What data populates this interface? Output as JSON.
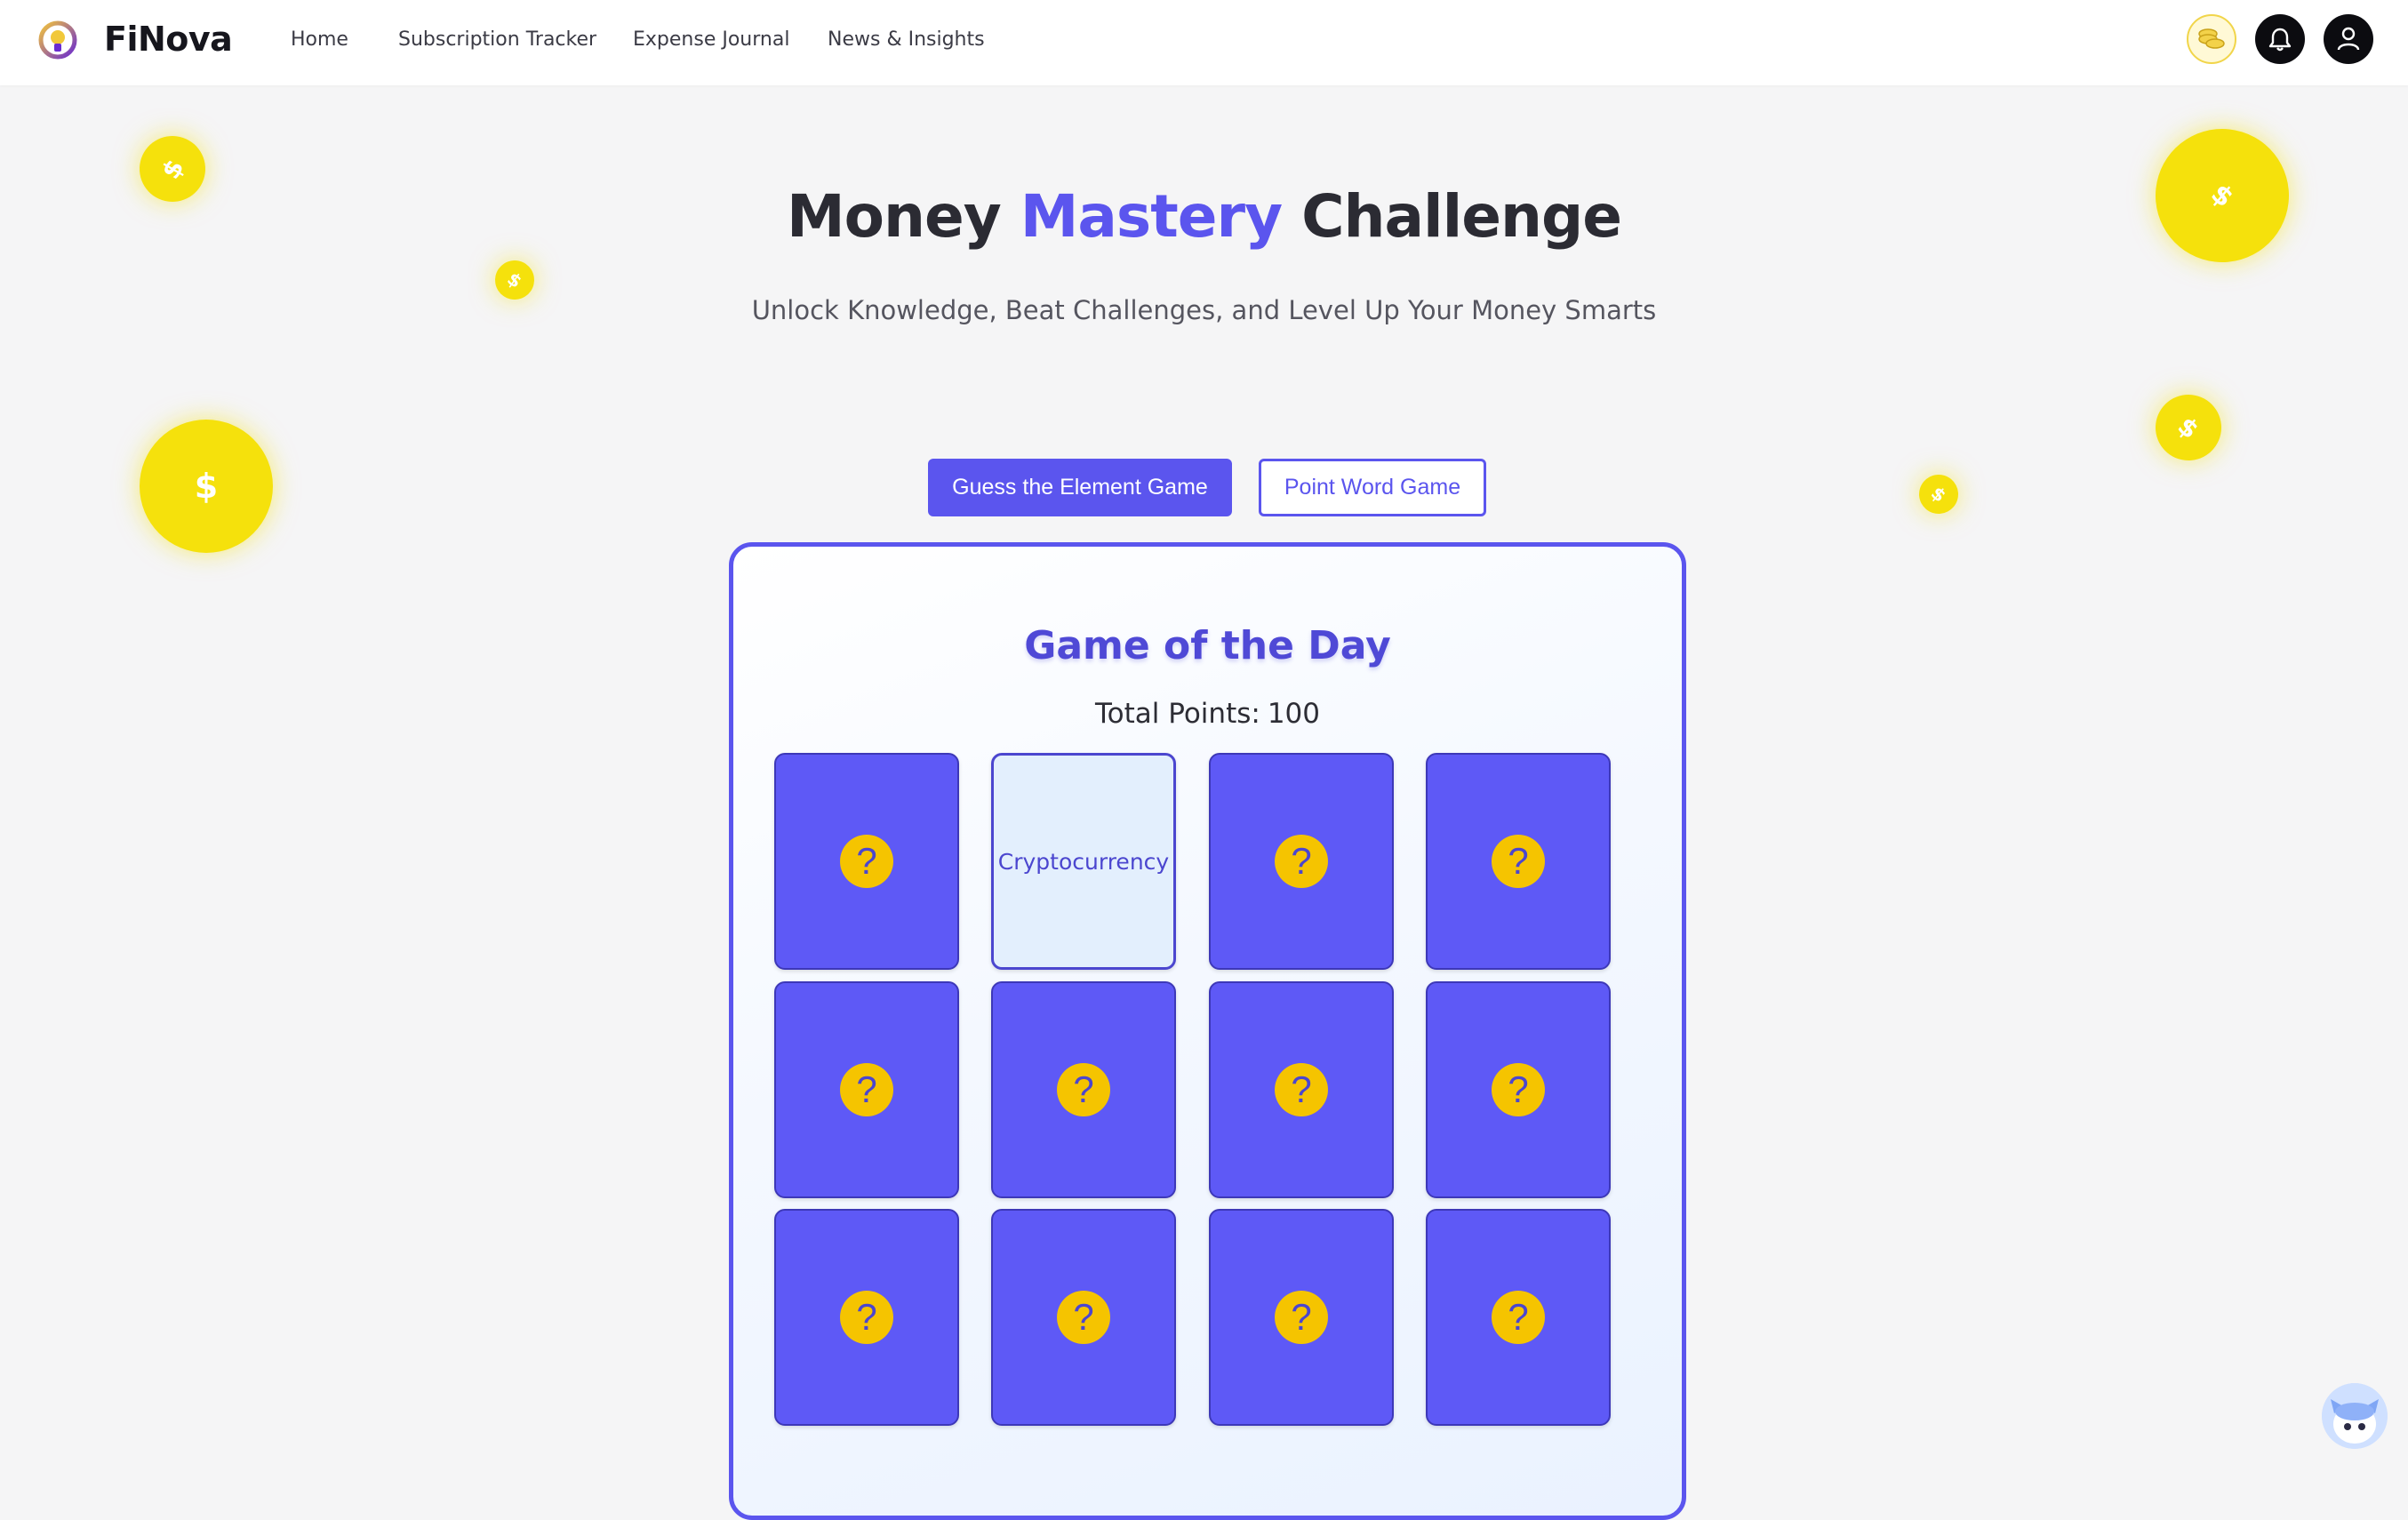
{
  "brand": {
    "name": "FiNova",
    "logo_icon": "lightbulb-logo-icon"
  },
  "nav": {
    "links": [
      "Home",
      "Subscription Tracker",
      "Expense Journal",
      "News & Insights"
    ],
    "icons": [
      "coins-icon",
      "bell-icon",
      "user-icon"
    ]
  },
  "hero": {
    "title_prefix": "Money ",
    "title_accent": "Mastery",
    "title_suffix": " Challenge",
    "subtitle": "Unlock Knowledge, Beat Challenges, and Level Up Your Money Smarts"
  },
  "tabs": {
    "active": "Guess the Element Game",
    "inactive": "Point Word Game"
  },
  "game": {
    "title": "Game of the Day",
    "points_label": "Total Points:",
    "points_value": "100",
    "hidden_symbol": "?",
    "tiles": [
      {
        "revealed": false,
        "word": ""
      },
      {
        "revealed": true,
        "word": "Cryptocurrency"
      },
      {
        "revealed": false,
        "word": ""
      },
      {
        "revealed": false,
        "word": ""
      },
      {
        "revealed": false,
        "word": ""
      },
      {
        "revealed": false,
        "word": ""
      },
      {
        "revealed": false,
        "word": ""
      },
      {
        "revealed": false,
        "word": ""
      },
      {
        "revealed": false,
        "word": ""
      },
      {
        "revealed": false,
        "word": ""
      },
      {
        "revealed": false,
        "word": ""
      },
      {
        "revealed": false,
        "word": ""
      }
    ]
  },
  "decor": {
    "coin_symbol": "$",
    "coin_color": "#f5e10c"
  },
  "colors": {
    "accent": "#5b55ee",
    "tile": "#5e59f6",
    "tile_badge": "#f5c400"
  },
  "chatbot": {
    "icon": "robot-chatbot-icon"
  }
}
